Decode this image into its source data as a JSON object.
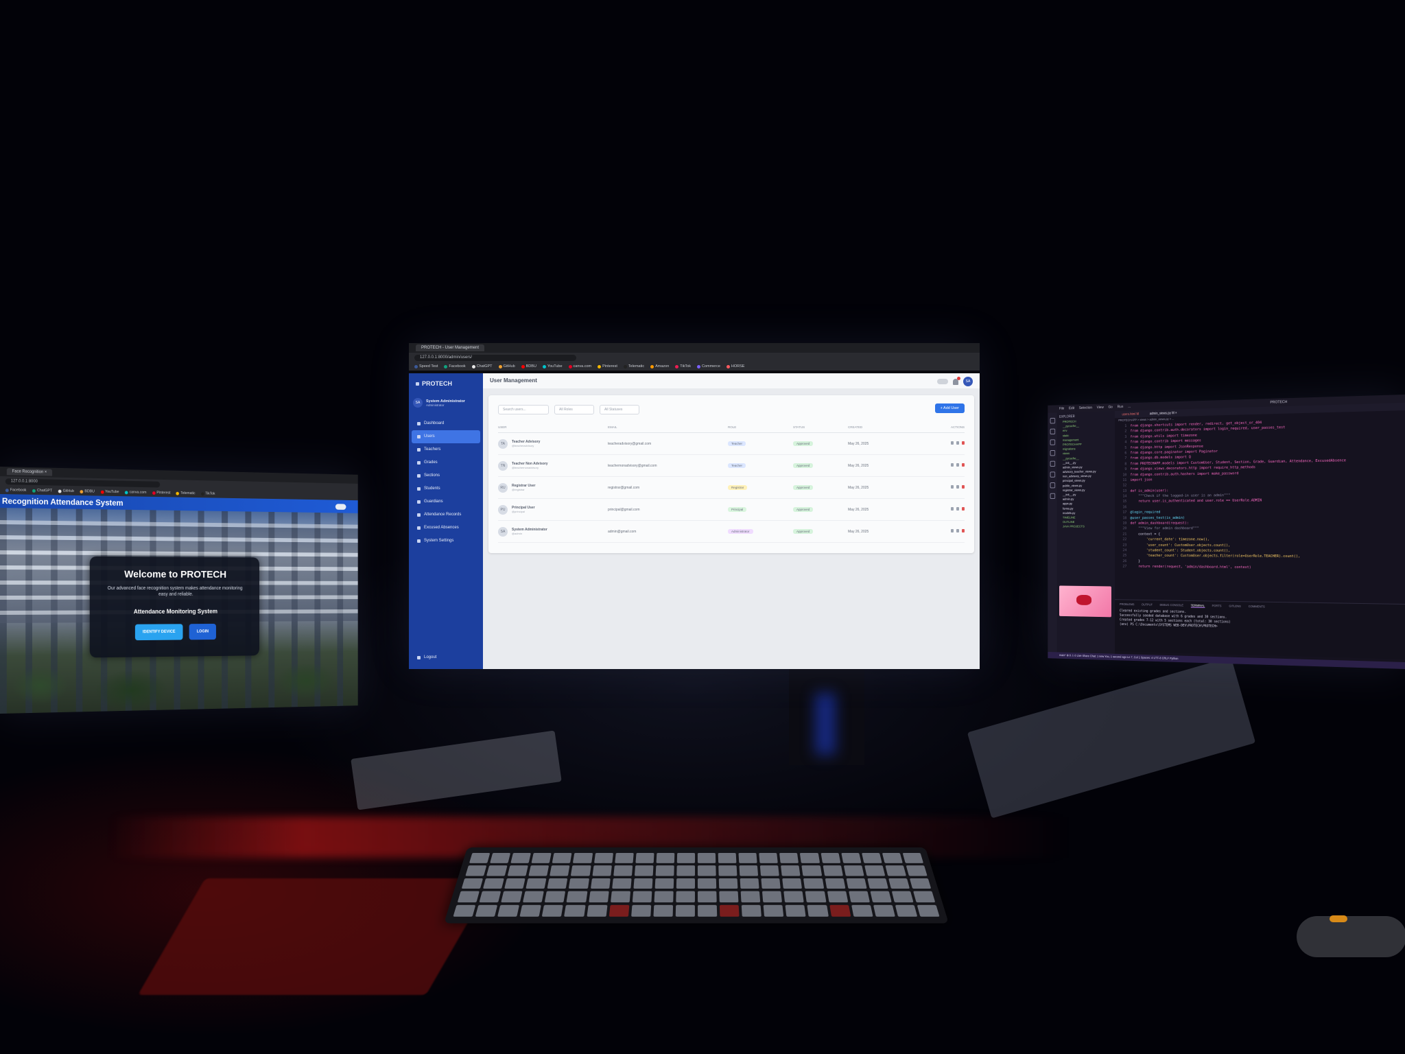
{
  "left_screen": {
    "tab_label": "Face Recognition ×",
    "url": "127.0.0.1:8000",
    "bookmarks": [
      "Facebook",
      "ChatGPT",
      "GitHub",
      "BDBU",
      "YouTube",
      "canva.com",
      "Pinterest",
      "Telematic",
      "TikTok"
    ],
    "header_title": "Recognition Attendance System",
    "welcome_title": "Welcome to PROTECH",
    "welcome_desc": "Our advanced face recognition system makes attendance monitoring easy and reliable.",
    "welcome_sub": "Attendance Monitoring System",
    "btn_primary": "IDENTIFY DEVICE",
    "btn_secondary": "LOGIN"
  },
  "center_screen": {
    "tab_label": "PROTECH - User Management",
    "url": "127.0.0.1:8000/admin/users/",
    "bookmarks": [
      "Speed Test",
      "Facebook",
      "ChatGPT",
      "GitHub",
      "BDBU",
      "YouTube",
      "canva.com",
      "Pinterest",
      "Telematic",
      "Amazon",
      "TikTok",
      "Commerce",
      "HORSE"
    ],
    "brand": "PROTECH",
    "user_initials": "SA",
    "user_name": "System Administrator",
    "user_role": "Administrator",
    "nav": [
      "Dashboard",
      "Users",
      "Teachers",
      "Grades",
      "Sections",
      "Students",
      "Guardians",
      "Attendance Records",
      "Excused Absences",
      "System Settings"
    ],
    "active_nav": 1,
    "logout": "Logout",
    "page_title": "User Management",
    "search_placeholder": "Search users...",
    "filter_roles": "All Roles",
    "filter_statuses": "All Statuses",
    "add_user": "+ Add User",
    "columns": [
      "USER",
      "EMAIL",
      "ROLE",
      "STATUS",
      "CREATED",
      "ACTIONS"
    ],
    "rows": [
      {
        "initials": "TA",
        "name": "Teacher Advisory",
        "sub": "@teacheradvisory",
        "email": "teacheradvisory@gmail.com",
        "role": "Teacher",
        "status": "Approved",
        "created": "May 26, 2025"
      },
      {
        "initials": "TN",
        "name": "Teacher Non Advisory",
        "sub": "@teachernonadvisory",
        "email": "teachernonadvisory@gmail.com",
        "role": "Teacher",
        "status": "Approved",
        "created": "May 26, 2025"
      },
      {
        "initials": "RU",
        "name": "Registrar User",
        "sub": "@registrar",
        "email": "registrar@gmail.com",
        "role": "Registrar",
        "status": "Approved",
        "created": "May 26, 2025"
      },
      {
        "initials": "PU",
        "name": "Principal User",
        "sub": "@principal",
        "email": "principal@gmail.com",
        "role": "Principal",
        "status": "Approved",
        "created": "May 26, 2025"
      },
      {
        "initials": "SA",
        "name": "System Administrator",
        "sub": "@admin",
        "email": "admin@gmail.com",
        "role": "Administrator",
        "status": "Approved",
        "created": "May 26, 2025"
      }
    ],
    "role_colors": {
      "Teacher": "#dbe6ff",
      "Registrar": "#fff1b8",
      "Principal": "#d9f5de",
      "Administrator": "#f0dcff"
    },
    "status_color": "#d6f3dc"
  },
  "right_screen": {
    "menu": [
      "File",
      "Edit",
      "Selection",
      "View",
      "Go",
      "Run",
      "..."
    ],
    "window_title": "PROTECH",
    "explorer_title": "EXPLORER",
    "tree": [
      {
        "t": "PROTECH",
        "k": "dir"
      },
      {
        "t": "__pycache__",
        "k": "dir"
      },
      {
        "t": "env",
        "k": "dir"
      },
      {
        "t": "static",
        "k": "dir"
      },
      {
        "t": "management",
        "k": "dir"
      },
      {
        "t": "PROTECHAPP",
        "k": "dir"
      },
      {
        "t": "migrations",
        "k": "dir"
      },
      {
        "t": "views",
        "k": "dir"
      },
      {
        "t": "__pycache__",
        "k": "dir"
      },
      {
        "t": "__init__.py",
        "k": "py"
      },
      {
        "t": "admin_views.py",
        "k": "py"
      },
      {
        "t": "advisory_teacher_views.py",
        "k": "py"
      },
      {
        "t": "non_advisory_views.py",
        "k": "py"
      },
      {
        "t": "principal_views.py",
        "k": "py"
      },
      {
        "t": "public_views.py",
        "k": "py"
      },
      {
        "t": "registrar_views.py",
        "k": "py"
      },
      {
        "t": "__init__.py",
        "k": "py"
      },
      {
        "t": "admin.py",
        "k": "py"
      },
      {
        "t": "apps.py",
        "k": "py"
      },
      {
        "t": "forms.py",
        "k": "py"
      },
      {
        "t": "models.py",
        "k": "py"
      },
      {
        "t": "TIMELINE",
        "k": "dir"
      },
      {
        "t": "OUTLINE",
        "k": "dir"
      },
      {
        "t": "JAVA PROJECTS",
        "k": "dir"
      }
    ],
    "tabs": [
      "users.html M",
      "admin_views.py M ×"
    ],
    "breadcrumb": "PROTECHAPP > views > admin_views.py > ...",
    "code": [
      "from django.shortcuts import render, redirect, get_object_or_404",
      "from django.contrib.auth.decorators import login_required, user_passes_test",
      "from django.utils import timezone",
      "from django.contrib import messages",
      "from django.http import JsonResponse",
      "from django.core.paginator import Paginator",
      "from django.db.models import Q",
      "from PROTECHAPP.models import CustomUser, Student, Section, Grade, Guardian, Attendance, ExcusedAbsence",
      "from django.views.decorators.http import require_http_methods",
      "from django.contrib.auth.hashers import make_password",
      "import json",
      "",
      "def is_admin(user):",
      "    \"\"\"Check if the logged-in user is an admin\"\"\"",
      "    return user.is_authenticated and user.role == UserRole.ADMIN",
      "",
      "@login_required",
      "@user_passes_test(is_admin)",
      "def admin_dashboard(request):",
      "    \"\"\"View for admin dashboard\"\"\"",
      "    context = {",
      "        'current_date': timezone.now(),",
      "        'user_count': CustomUser.objects.count(),",
      "        'student_count': Student.objects.count(),",
      "        'teacher_count': CustomUser.objects.filter(role=UserRole.TEACHER).count(),",
      "    }",
      "    return render(request, 'admin/dashboard.html', context)"
    ],
    "panel_tabs": [
      "PROBLEMS",
      "OUTPUT",
      "DEBUG CONSOLE",
      "TERMINAL",
      "PORTS",
      "GITLENS",
      "COMMENTS"
    ],
    "active_panel": 3,
    "terminal": [
      "Cleared existing grades and sections.",
      "Successfully seeded database with 6 grades and 30 sections.",
      "Created grades 7-12 with 5 sections each (total: 30 sections)",
      "(env) PS C:\\Documents\\SYSTEMS WEB-DEV\\PROTECH\\PROTECH>"
    ],
    "status_bar": "main*  ⊗ 0 ⚠ 0   Live Share   Chat: 1 new   You, 1 second ago   Ln 7, Col 1   Spaces: 4   UTF-8   CRLF   Python"
  }
}
